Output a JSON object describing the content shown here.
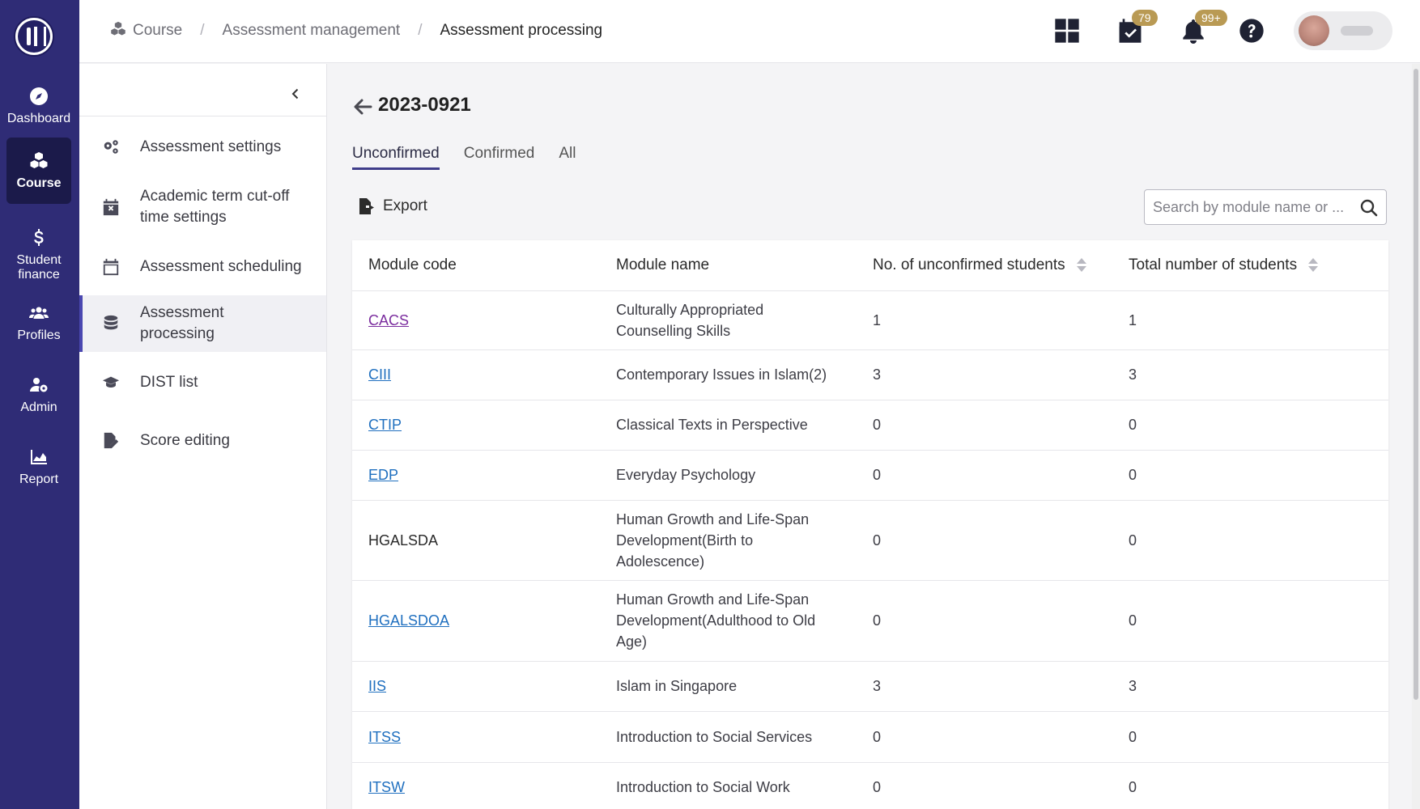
{
  "rail": {
    "items": [
      {
        "label": "Dashboard",
        "icon": "compass-icon"
      },
      {
        "label": "Course",
        "icon": "cubes-icon"
      },
      {
        "label": "Student finance",
        "icon": "dollar-icon"
      },
      {
        "label": "Profiles",
        "icon": "users-icon"
      },
      {
        "label": "Admin",
        "icon": "user-gear-icon"
      },
      {
        "label": "Report",
        "icon": "area-chart-icon"
      }
    ],
    "active": "Course"
  },
  "breadcrumb": {
    "items": [
      "Course",
      "Assessment management",
      "Assessment processing"
    ]
  },
  "header": {
    "tasks_badge": "79",
    "notifications_badge": "99+"
  },
  "subnav": {
    "items": [
      {
        "label": "Assessment settings",
        "icon": "gears-icon"
      },
      {
        "label": "Academic term cut-off time settings",
        "icon": "calendar-x-icon"
      },
      {
        "label": "Assessment scheduling",
        "icon": "calendar-icon"
      },
      {
        "label": "Assessment processing",
        "icon": "database-icon"
      },
      {
        "label": "DIST list",
        "icon": "graduation-cap-icon"
      },
      {
        "label": "Score editing",
        "icon": "file-edit-icon"
      }
    ],
    "active": "Assessment processing"
  },
  "main": {
    "title": "2023-0921",
    "tabs": [
      "Unconfirmed",
      "Confirmed",
      "All"
    ],
    "active_tab": "Unconfirmed",
    "export_label": "Export",
    "search_placeholder": "Search by module name or ..."
  },
  "table": {
    "headers": [
      "Module code",
      "Module name",
      "No. of unconfirmed students",
      "Total number of students"
    ],
    "rows": [
      {
        "code": "CACS",
        "name": "Culturally Appropriated Counselling Skills",
        "unconfirmed": "1",
        "total": "1"
      },
      {
        "code": "CIII",
        "name": "Contemporary Issues in Islam(2)",
        "unconfirmed": "3",
        "total": "3"
      },
      {
        "code": "CTIP",
        "name": "Classical Texts in Perspective",
        "unconfirmed": "0",
        "total": "0"
      },
      {
        "code": "EDP",
        "name": "Everyday Psychology",
        "unconfirmed": "0",
        "total": "0"
      },
      {
        "code": "HGALSDA",
        "name": "Human Growth and Life-Span Development(Birth to Adolescence)",
        "unconfirmed": "0",
        "total": "0"
      },
      {
        "code": "HGALSDOA",
        "name": "Human Growth and Life-Span Development(Adulthood to Old Age)",
        "unconfirmed": "0",
        "total": "0"
      },
      {
        "code": "IIS",
        "name": "Islam in Singapore",
        "unconfirmed": "3",
        "total": "3"
      },
      {
        "code": "ITSS",
        "name": "Introduction to Social Services",
        "unconfirmed": "0",
        "total": "0"
      },
      {
        "code": "ITSW",
        "name": "Introduction to Social Work",
        "unconfirmed": "0",
        "total": "0"
      }
    ]
  },
  "colors": {
    "rail_bg": "#2f2c76",
    "rail_active": "#1b1a4a",
    "link": "#1f6fbf",
    "visited_link": "#7b2d9e",
    "badge": "#b99a54",
    "active_tab_underline": "#3f3d8a"
  }
}
